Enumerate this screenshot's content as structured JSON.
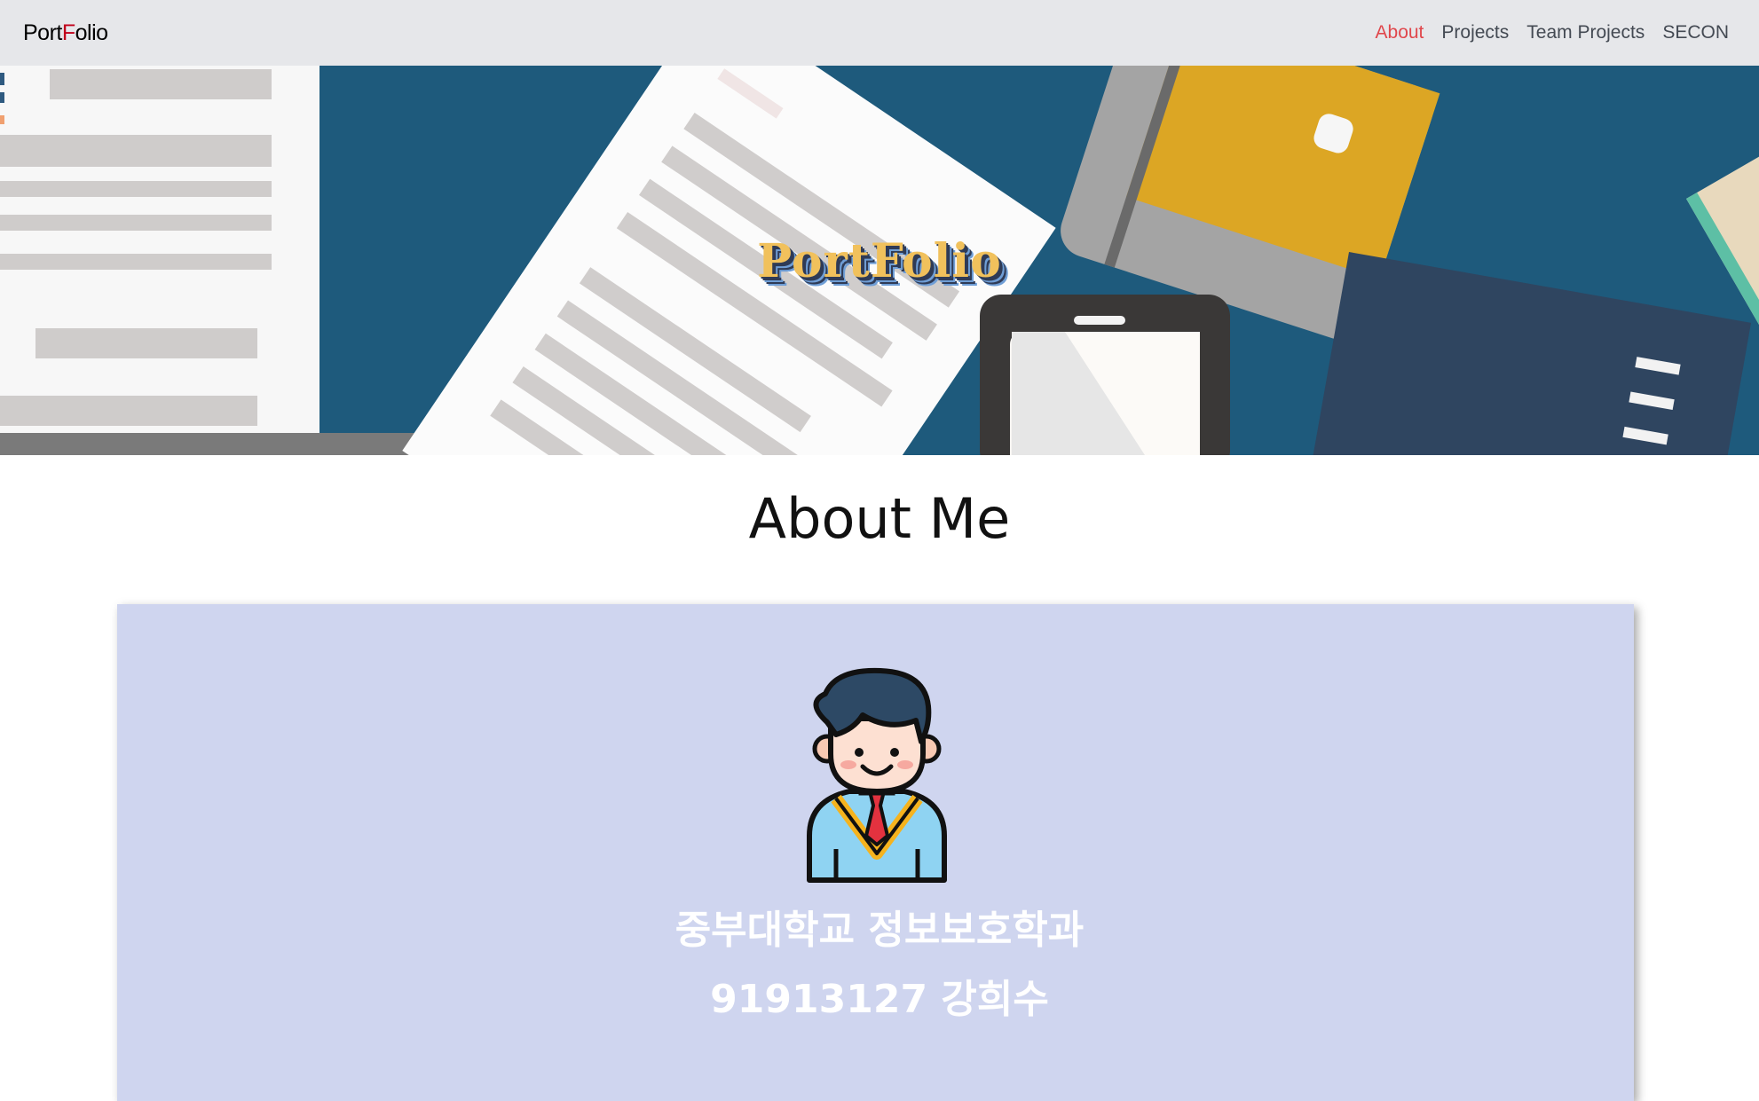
{
  "navbar": {
    "brand_parts": [
      "Port",
      "F",
      "olio"
    ],
    "links": [
      {
        "label": "About",
        "active": true
      },
      {
        "label": "Projects",
        "active": false
      },
      {
        "label": "Team Projects",
        "active": false
      },
      {
        "label": "SECON",
        "active": false
      }
    ],
    "active_color": "#e0474c",
    "brand_accent": "#c0001a"
  },
  "hero": {
    "title": "PortFolio",
    "background_color": "#1e5a7c"
  },
  "about": {
    "heading": "About Me",
    "card_color": "#cfd5ef",
    "line1": "중부대학교 정보보호학과",
    "line2": "91913127 강희수",
    "avatar_icon": "student-avatar-icon"
  }
}
